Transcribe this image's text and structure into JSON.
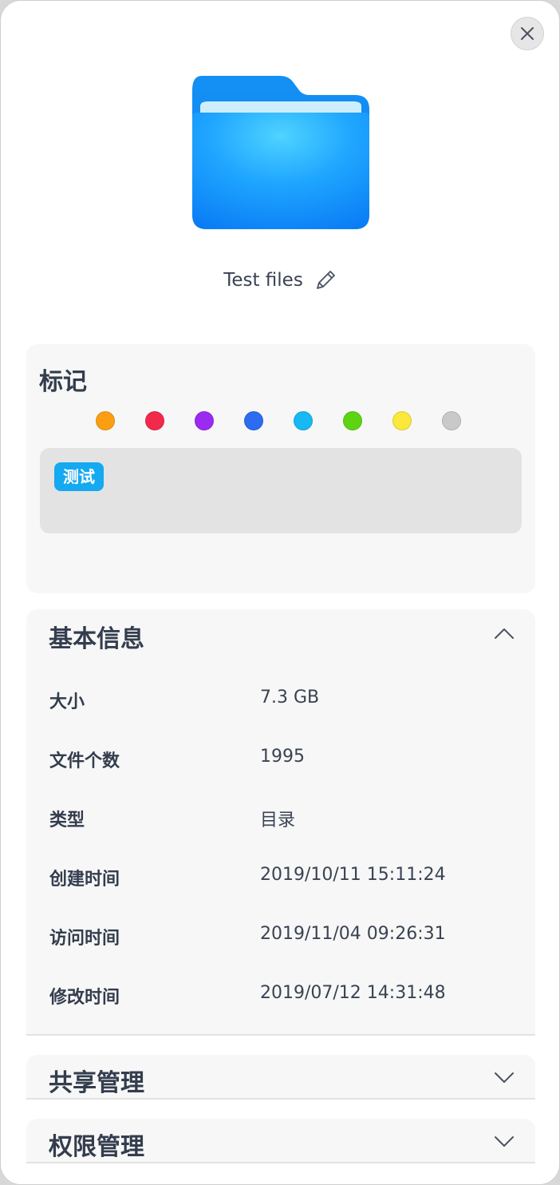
{
  "file": {
    "name": "Test files",
    "icon": "folder-icon"
  },
  "tags": {
    "title": "标记",
    "colors": [
      {
        "name": "orange",
        "hex": "#fb9e12"
      },
      {
        "name": "red",
        "hex": "#f2294b"
      },
      {
        "name": "purple",
        "hex": "#9b2bf0"
      },
      {
        "name": "blue",
        "hex": "#2c6cf0"
      },
      {
        "name": "cyan",
        "hex": "#18b8f2"
      },
      {
        "name": "green",
        "hex": "#5dd412"
      },
      {
        "name": "yellow",
        "hex": "#fbe83b"
      },
      {
        "name": "gray",
        "hex": "#c9c9c9"
      }
    ],
    "applied": [
      {
        "label": "测试",
        "color": "#14a9f0"
      }
    ]
  },
  "basic_info": {
    "title": "基本信息",
    "expanded": true,
    "rows": [
      {
        "label": "大小",
        "value": "7.3 GB"
      },
      {
        "label": "文件个数",
        "value": "1995"
      },
      {
        "label": "类型",
        "value": "目录"
      },
      {
        "label": "创建时间",
        "value": "2019/10/11 15:11:24"
      },
      {
        "label": "访问时间",
        "value": "2019/11/04 09:26:31"
      },
      {
        "label": "修改时间",
        "value": "2019/07/12 14:31:48"
      }
    ]
  },
  "share_management": {
    "title": "共享管理",
    "expanded": false
  },
  "permission_management": {
    "title": "权限管理",
    "expanded": false
  },
  "colors": {
    "accent": "#14a9f0",
    "text_primary": "#333d4d",
    "panel_bg": "#f7f7f7"
  }
}
